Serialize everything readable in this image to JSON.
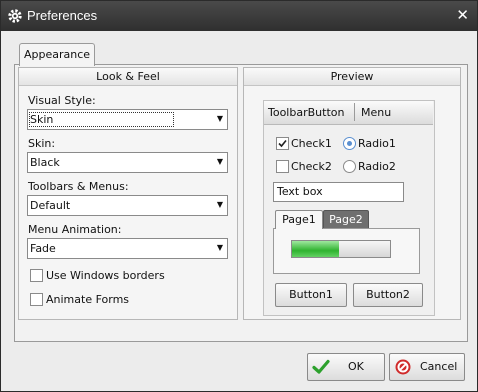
{
  "window": {
    "title": "Preferences"
  },
  "tabs": [
    {
      "label": "Appearance"
    }
  ],
  "look_feel": {
    "header": "Look & Feel",
    "visual_style": {
      "label": "Visual Style:",
      "value": "Skin"
    },
    "skin": {
      "label": "Skin:",
      "value": "Black"
    },
    "toolbars_menus": {
      "label": "Toolbars & Menus:",
      "value": "Default"
    },
    "menu_animation": {
      "label": "Menu Animation:",
      "value": "Fade"
    },
    "use_windows_borders": {
      "label": "Use Windows borders",
      "checked": false
    },
    "animate_forms": {
      "label": "Animate Forms",
      "checked": false
    }
  },
  "preview": {
    "header": "Preview",
    "toolbar": {
      "button": "ToolbarButton",
      "menu": "Menu"
    },
    "check1": {
      "label": "Check1",
      "checked": true
    },
    "check2": {
      "label": "Check2",
      "checked": false
    },
    "radio1": {
      "label": "Radio1",
      "selected": true
    },
    "radio2": {
      "label": "Radio2",
      "selected": false
    },
    "textbox": "Text box",
    "page_tabs": [
      "Page1",
      "Page2"
    ],
    "progress": 0.48,
    "button1": "Button1",
    "button2": "Button2"
  },
  "footer": {
    "ok": "OK",
    "cancel": "Cancel"
  },
  "colors": {
    "progress": "#3fc23f",
    "ok_icon": "#2da12d",
    "cancel_icon": "#d02a2a",
    "page2_tab": "#6f6f6f"
  }
}
